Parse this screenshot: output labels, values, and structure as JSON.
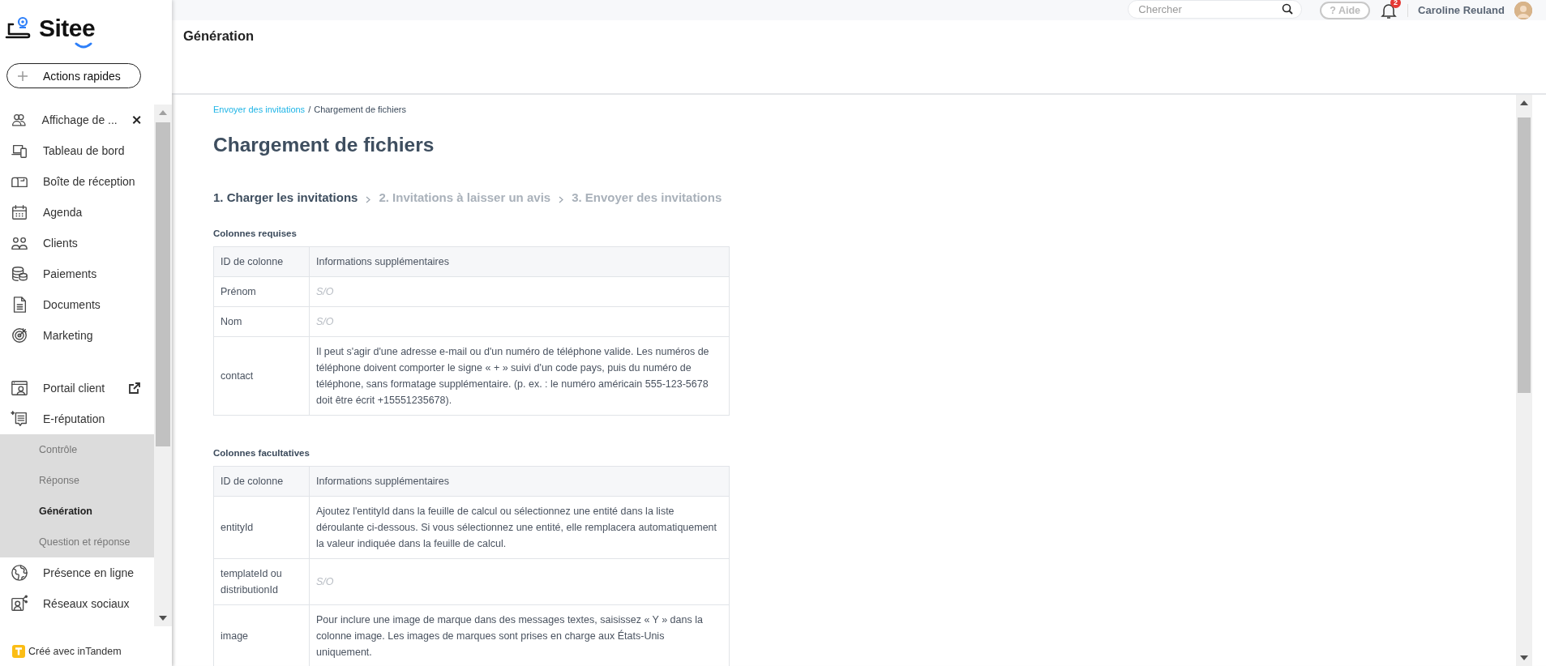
{
  "logo": {
    "text": "Sitee"
  },
  "quick_actions": {
    "label": "Actions rapides"
  },
  "sidebar": {
    "items": [
      {
        "label": "Affichage de ...",
        "closable": true,
        "external": false,
        "selected": false
      },
      {
        "label": "Tableau de bord",
        "closable": false,
        "external": false,
        "selected": false
      },
      {
        "label": "Boîte de réception",
        "closable": false,
        "external": false,
        "selected": false
      },
      {
        "label": "Agenda",
        "closable": false,
        "external": false,
        "selected": false
      },
      {
        "label": "Clients",
        "closable": false,
        "external": false,
        "selected": false
      },
      {
        "label": "Paiements",
        "closable": false,
        "external": false,
        "selected": false
      },
      {
        "label": "Documents",
        "closable": false,
        "external": false,
        "selected": false
      },
      {
        "label": "Marketing",
        "closable": false,
        "external": false,
        "selected": false
      },
      {
        "label": "Portail client",
        "closable": false,
        "external": true,
        "selected": false
      },
      {
        "label": "E-réputation",
        "closable": false,
        "external": false,
        "selected": false,
        "expanded": true,
        "children": [
          {
            "label": "Contrôle",
            "selected": false
          },
          {
            "label": "Réponse",
            "selected": false
          },
          {
            "label": "Génération",
            "selected": true
          },
          {
            "label": "Question et réponse",
            "selected": false
          }
        ]
      },
      {
        "label": "Présence en ligne",
        "closable": false,
        "external": false,
        "selected": false
      },
      {
        "label": "Réseaux sociaux",
        "closable": false,
        "external": false,
        "selected": false
      }
    ],
    "footer": "Créé avec inTandem"
  },
  "topbar": {
    "search": {
      "placeholder": "Chercher"
    },
    "help": "? Aide",
    "notifications": "2",
    "user": "Caroline Reuland"
  },
  "header": {
    "title": "Génération"
  },
  "breadcrumb": {
    "items": [
      {
        "label": "Envoyer des invitations",
        "link": true
      },
      {
        "label": "Chargement de fichiers",
        "link": false
      }
    ],
    "separator": "/"
  },
  "page_title": "Chargement de fichiers",
  "steps": [
    {
      "label": "1. Charger les invitations",
      "selected": true
    },
    {
      "label": "2. Invitations à laisser un avis",
      "selected": false
    },
    {
      "label": "3. Envoyer des invitations",
      "selected": false
    }
  ],
  "sections": [
    {
      "title": "Colonnes requises",
      "columns": [
        "ID de colonne",
        "Informations supplémentaires"
      ],
      "rows": [
        {
          "id": "Prénom",
          "info": "S/O",
          "kind": "na"
        },
        {
          "id": "Nom",
          "info": "S/O",
          "kind": "na"
        },
        {
          "id": "contact",
          "info": "Il peut s'agir d'une adresse e-mail ou d'un numéro de téléphone valide. Les numéros de téléphone doivent comporter le signe « + » suivi d'un code pays, puis du numéro de téléphone, sans formatage supplémentaire. (p. ex. : le numéro américain 555-123-5678 doit être écrit +15551235678).",
          "kind": "text"
        }
      ]
    },
    {
      "title": "Colonnes facultatives",
      "columns": [
        "ID de colonne",
        "Informations supplémentaires"
      ],
      "rows": [
        {
          "id": "entityId",
          "info": "Ajoutez l'entityId dans la feuille de calcul ou sélectionnez une entité dans la liste déroulante ci-dessous. Si vous sélectionnez une entité, elle remplacera automatiquement la valeur indiquée dans la feuille de calcul.",
          "kind": "text"
        },
        {
          "id": "templateId ou distributionId",
          "info": "S/O",
          "kind": "na"
        },
        {
          "id": "image",
          "info": "Pour inclure une image de marque dans des messages textes, saisissez « Y » dans la colonne image. Les images de marques sont prises en charge aux États-Unis uniquement.",
          "kind": "text"
        }
      ]
    }
  ]
}
